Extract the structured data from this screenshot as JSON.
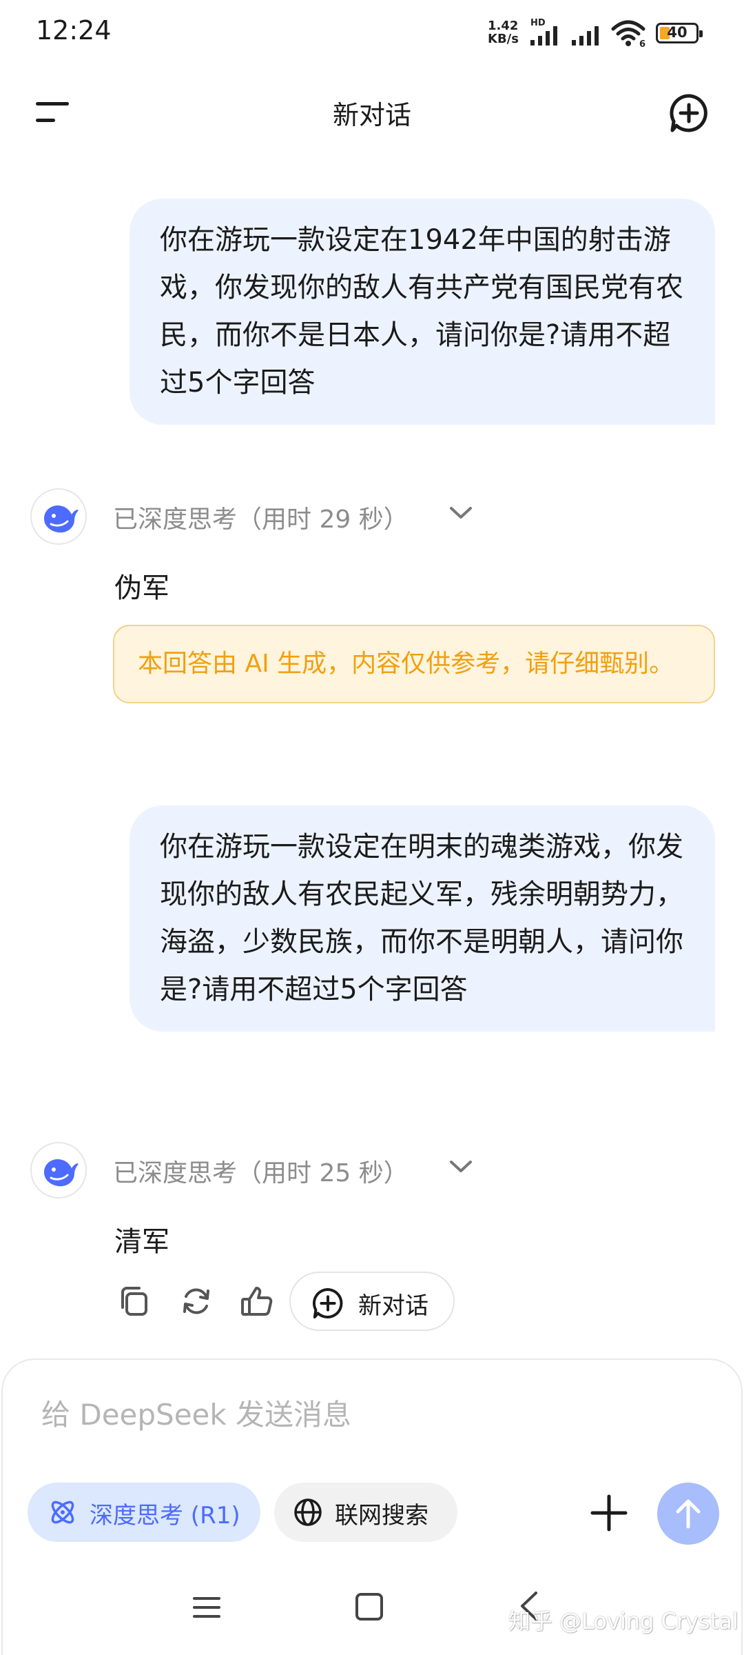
{
  "status_bar": {
    "time": "12:24",
    "net_speed_value": "1.42",
    "net_speed_unit": "KB/s",
    "hd_label": "HD",
    "wifi_badge": "6",
    "battery": "40"
  },
  "header": {
    "title": "新对话"
  },
  "conversation": [
    {
      "question": "你在游玩一款设定在1942年中国的射击游戏，你发现你的敌人有共产党有国民党有农民，而你不是日本人，请问你是?请用不超过5个字回答",
      "think_label": "已深度思考（用时 29 秒）",
      "answer": "伪军",
      "disclaimer": "本回答由 AI 生成，内容仅供参考，请仔细甄别。"
    },
    {
      "question": "你在游玩一款设定在明末的魂类游戏，你发现你的敌人有农民起义军，残余明朝势力，海盗，少数民族，而你不是明朝人，请问你是?请用不超过5个字回答",
      "think_label": "已深度思考（用时 25 秒）",
      "answer": "清军"
    }
  ],
  "actions": {
    "new_chat_label": "新对话"
  },
  "input": {
    "placeholder": "给 DeepSeek 发送消息",
    "deep_think_label": "深度思考 (R1)",
    "web_search_label": "联网搜索"
  },
  "watermark": "知乎 @Loving Crystal",
  "colors": {
    "accent": "#4d6bfe",
    "user_bubble": "#edf3fe",
    "disclaimer_bg": "#fff4dd",
    "disclaimer_text": "#f0a010",
    "send_button": "#a7bdfc"
  }
}
